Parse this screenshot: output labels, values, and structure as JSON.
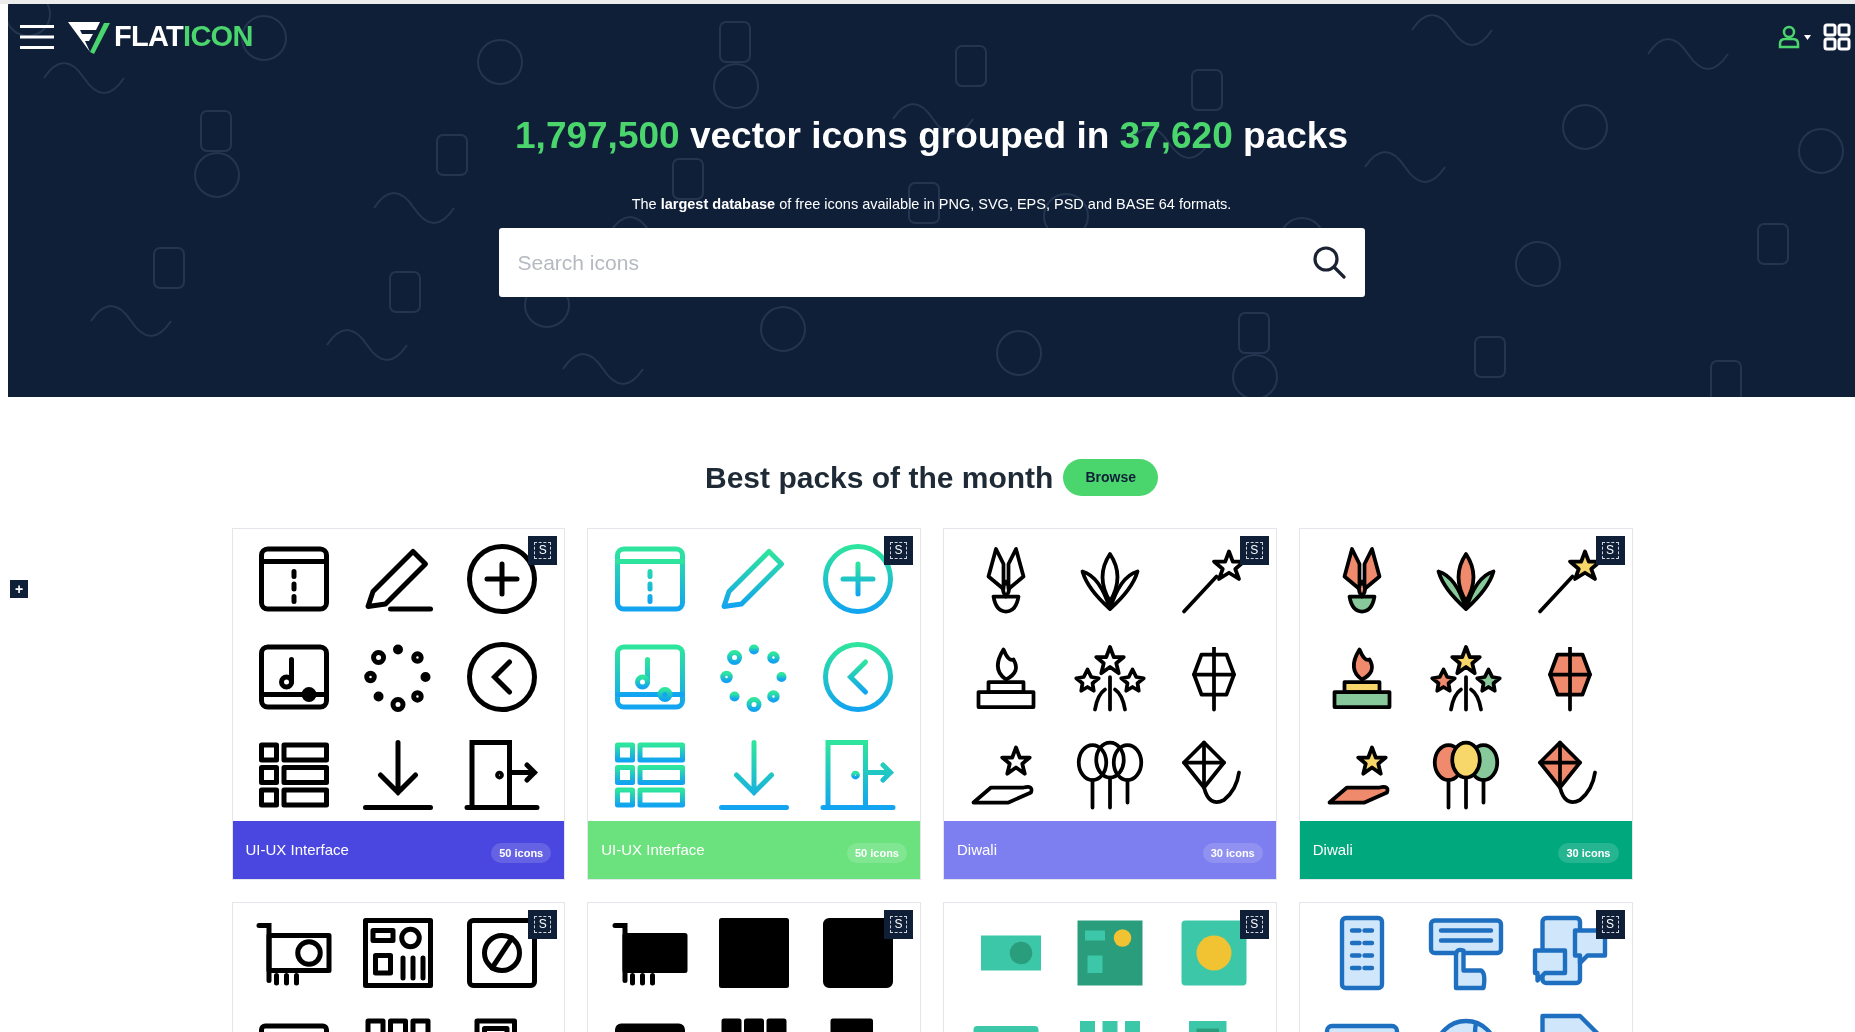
{
  "header": {
    "logo": {
      "part1": "FLAT",
      "part2": "ICON"
    },
    "headline": {
      "count_icons": "1,797,500",
      "text1": "vector icons grouped in",
      "count_packs": "37,620",
      "text2": "packs"
    },
    "subtitle": "The **largest database** of free icons available in PNG, SVG, EPS, PSD and BASE 64 formats.",
    "search": {
      "placeholder": "Search icons"
    }
  },
  "section": {
    "title": "Best packs of the month",
    "browse_button": "Browse"
  },
  "side_button": "+",
  "packs": [
    {
      "kind": "interface",
      "badge": "S",
      "name": "UI-UX Interface",
      "count": "50 icons",
      "color": "#4a47e0"
    },
    {
      "kind": "interface",
      "badge": "S",
      "name": "UI-UX Interface",
      "count": "50 icons",
      "color": "#6ce27f"
    },
    {
      "kind": "festival",
      "badge": "S",
      "name": "Diwali",
      "count": "30 icons",
      "color": "#7d7eef"
    },
    {
      "kind": "festival",
      "badge": "S",
      "name": "Diwali",
      "count": "30 icons",
      "color": "#00a87e"
    },
    {
      "kind": "hardware",
      "badge": "S"
    },
    {
      "kind": "hardware",
      "badge": "S"
    },
    {
      "kind": "hardware",
      "badge": "S"
    },
    {
      "kind": "devices",
      "badge": "S"
    }
  ]
}
